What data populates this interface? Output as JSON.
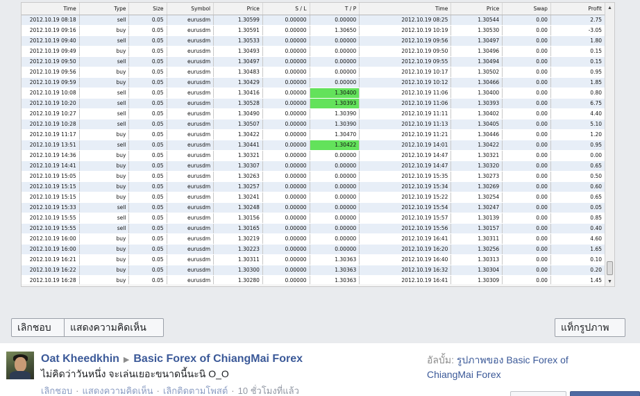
{
  "trade_table": {
    "columns": [
      "Time",
      "Type",
      "Size",
      "Symbol",
      "Price",
      "S / L",
      "T / P",
      "",
      "Time",
      "Price",
      "Swap",
      "Profit"
    ],
    "rows": [
      [
        "2012.10.19 08:18",
        "sell",
        "0.05",
        "eurusdm",
        "1.30599",
        "0.00000",
        "0.00000",
        "",
        "2012.10.19 08:25",
        "1.30544",
        "0.00",
        "2.75"
      ],
      [
        "2012.10.19 09:16",
        "buy",
        "0.05",
        "eurusdm",
        "1.30591",
        "0.00000",
        "1.30650",
        "",
        "2012.10.19 10:19",
        "1.30530",
        "0.00",
        "-3.05"
      ],
      [
        "2012.10.19 09:40",
        "sell",
        "0.05",
        "eurusdm",
        "1.30533",
        "0.00000",
        "0.00000",
        "",
        "2012.10.19 09:56",
        "1.30497",
        "0.00",
        "1.80"
      ],
      [
        "2012.10.19 09:49",
        "buy",
        "0.05",
        "eurusdm",
        "1.30493",
        "0.00000",
        "0.00000",
        "",
        "2012.10.19 09:50",
        "1.30496",
        "0.00",
        "0.15"
      ],
      [
        "2012.10.19 09:50",
        "sell",
        "0.05",
        "eurusdm",
        "1.30497",
        "0.00000",
        "0.00000",
        "",
        "2012.10.19 09:55",
        "1.30494",
        "0.00",
        "0.15"
      ],
      [
        "2012.10.19 09:56",
        "buy",
        "0.05",
        "eurusdm",
        "1.30483",
        "0.00000",
        "0.00000",
        "",
        "2012.10.19 10:17",
        "1.30502",
        "0.00",
        "0.95"
      ],
      [
        "2012.10.19 09:59",
        "buy",
        "0.05",
        "eurusdm",
        "1.30429",
        "0.00000",
        "0.00000",
        "",
        "2012.10.19 10:12",
        "1.30466",
        "0.00",
        "1.85"
      ],
      [
        "2012.10.19 10:08",
        "sell",
        "0.05",
        "eurusdm",
        "1.30416",
        "0.00000",
        "1.30400",
        "",
        "2012.10.19 11:06",
        "1.30400",
        "0.00",
        "0.80"
      ],
      [
        "2012.10.19 10:20",
        "sell",
        "0.05",
        "eurusdm",
        "1.30528",
        "0.00000",
        "1.30393",
        "",
        "2012.10.19 11:06",
        "1.30393",
        "0.00",
        "6.75"
      ],
      [
        "2012.10.19 10:27",
        "sell",
        "0.05",
        "eurusdm",
        "1.30490",
        "0.00000",
        "1.30390",
        "",
        "2012.10.19 11:11",
        "1.30402",
        "0.00",
        "4.40"
      ],
      [
        "2012.10.19 10:28",
        "sell",
        "0.05",
        "eurusdm",
        "1.30507",
        "0.00000",
        "1.30390",
        "",
        "2012.10.19 11:13",
        "1.30405",
        "0.00",
        "5.10"
      ],
      [
        "2012.10.19 11:17",
        "buy",
        "0.05",
        "eurusdm",
        "1.30422",
        "0.00000",
        "1.30470",
        "",
        "2012.10.19 11:21",
        "1.30446",
        "0.00",
        "1.20"
      ],
      [
        "2012.10.19 13:51",
        "sell",
        "0.05",
        "eurusdm",
        "1.30441",
        "0.00000",
        "1.30422",
        "",
        "2012.10.19 14:01",
        "1.30422",
        "0.00",
        "0.95"
      ],
      [
        "2012.10.19 14:36",
        "buy",
        "0.05",
        "eurusdm",
        "1.30321",
        "0.00000",
        "0.00000",
        "",
        "2012.10.19 14:47",
        "1.30321",
        "0.00",
        "0.00"
      ],
      [
        "2012.10.19 14:41",
        "buy",
        "0.05",
        "eurusdm",
        "1.30307",
        "0.00000",
        "0.00000",
        "",
        "2012.10.19 14:47",
        "1.30320",
        "0.00",
        "0.65"
      ],
      [
        "2012.10.19 15:05",
        "buy",
        "0.05",
        "eurusdm",
        "1.30263",
        "0.00000",
        "0.00000",
        "",
        "2012.10.19 15:35",
        "1.30273",
        "0.00",
        "0.50"
      ],
      [
        "2012.10.19 15:15",
        "buy",
        "0.05",
        "eurusdm",
        "1.30257",
        "0.00000",
        "0.00000",
        "",
        "2012.10.19 15:34",
        "1.30269",
        "0.00",
        "0.60"
      ],
      [
        "2012.10.19 15:15",
        "buy",
        "0.05",
        "eurusdm",
        "1.30241",
        "0.00000",
        "0.00000",
        "",
        "2012.10.19 15:22",
        "1.30254",
        "0.00",
        "0.65"
      ],
      [
        "2012.10.19 15:33",
        "sell",
        "0.05",
        "eurusdm",
        "1.30248",
        "0.00000",
        "0.00000",
        "",
        "2012.10.19 15:54",
        "1.30247",
        "0.00",
        "0.05"
      ],
      [
        "2012.10.19 15:55",
        "sell",
        "0.05",
        "eurusdm",
        "1.30156",
        "0.00000",
        "0.00000",
        "",
        "2012.10.19 15:57",
        "1.30139",
        "0.00",
        "0.85"
      ],
      [
        "2012.10.19 15:55",
        "sell",
        "0.05",
        "eurusdm",
        "1.30165",
        "0.00000",
        "0.00000",
        "",
        "2012.10.19 15:56",
        "1.30157",
        "0.00",
        "0.40"
      ],
      [
        "2012.10.19 16:00",
        "buy",
        "0.05",
        "eurusdm",
        "1.30219",
        "0.00000",
        "0.00000",
        "",
        "2012.10.19 16:41",
        "1.30311",
        "0.00",
        "4.60"
      ],
      [
        "2012.10.19 16:00",
        "buy",
        "0.05",
        "eurusdm",
        "1.30223",
        "0.00000",
        "0.00000",
        "",
        "2012.10.19 16:20",
        "1.30256",
        "0.00",
        "1.65"
      ],
      [
        "2012.10.19 16:21",
        "buy",
        "0.05",
        "eurusdm",
        "1.30311",
        "0.00000",
        "1.30363",
        "",
        "2012.10.19 16:40",
        "1.30313",
        "0.00",
        "0.10"
      ],
      [
        "2012.10.19 16:22",
        "buy",
        "0.05",
        "eurusdm",
        "1.30300",
        "0.00000",
        "1.30363",
        "",
        "2012.10.19 16:32",
        "1.30304",
        "0.00",
        "0.20"
      ],
      [
        "2012.10.19 16:28",
        "buy",
        "0.05",
        "eurusdm",
        "1.30280",
        "0.00000",
        "1.30363",
        "",
        "2012.10.19 16:41",
        "1.30309",
        "0.00",
        "1.45"
      ]
    ],
    "highlight_color": "#63e25b",
    "highlighted_tp_rows": [
      7,
      8,
      12
    ]
  },
  "photo_actions": {
    "like_label": "เลิกชอบ",
    "comment_label": "แสดงความคิดเห็น",
    "tag_label": "แท็กรูปภาพ"
  },
  "post": {
    "author": "Oat Kheedkhin",
    "separator_icon": "triangle-right-icon",
    "group": "Basic Forex of ChiangMai Forex",
    "text": "ไม่คิดว่าวันหนึ่ง จะเล่นเยอะขนาดนี้นะนิ O_O",
    "actions": {
      "unlike": "เลิกชอบ",
      "comment": "แสดงความคิดเห็น",
      "unfollow": "เลิกติดตามโพสต์",
      "time": "10 ชั่วโมงที่แล้ว"
    }
  },
  "album": {
    "label": "อัลบั้ม:",
    "link_line1": "รูปภาพของ Basic Forex of",
    "link_line2": "ChiangMai Forex"
  },
  "colors": {
    "facebook_blue": "#3b5998",
    "panel_background": "#e9ebee",
    "row_stripe": "#e7eef7"
  }
}
